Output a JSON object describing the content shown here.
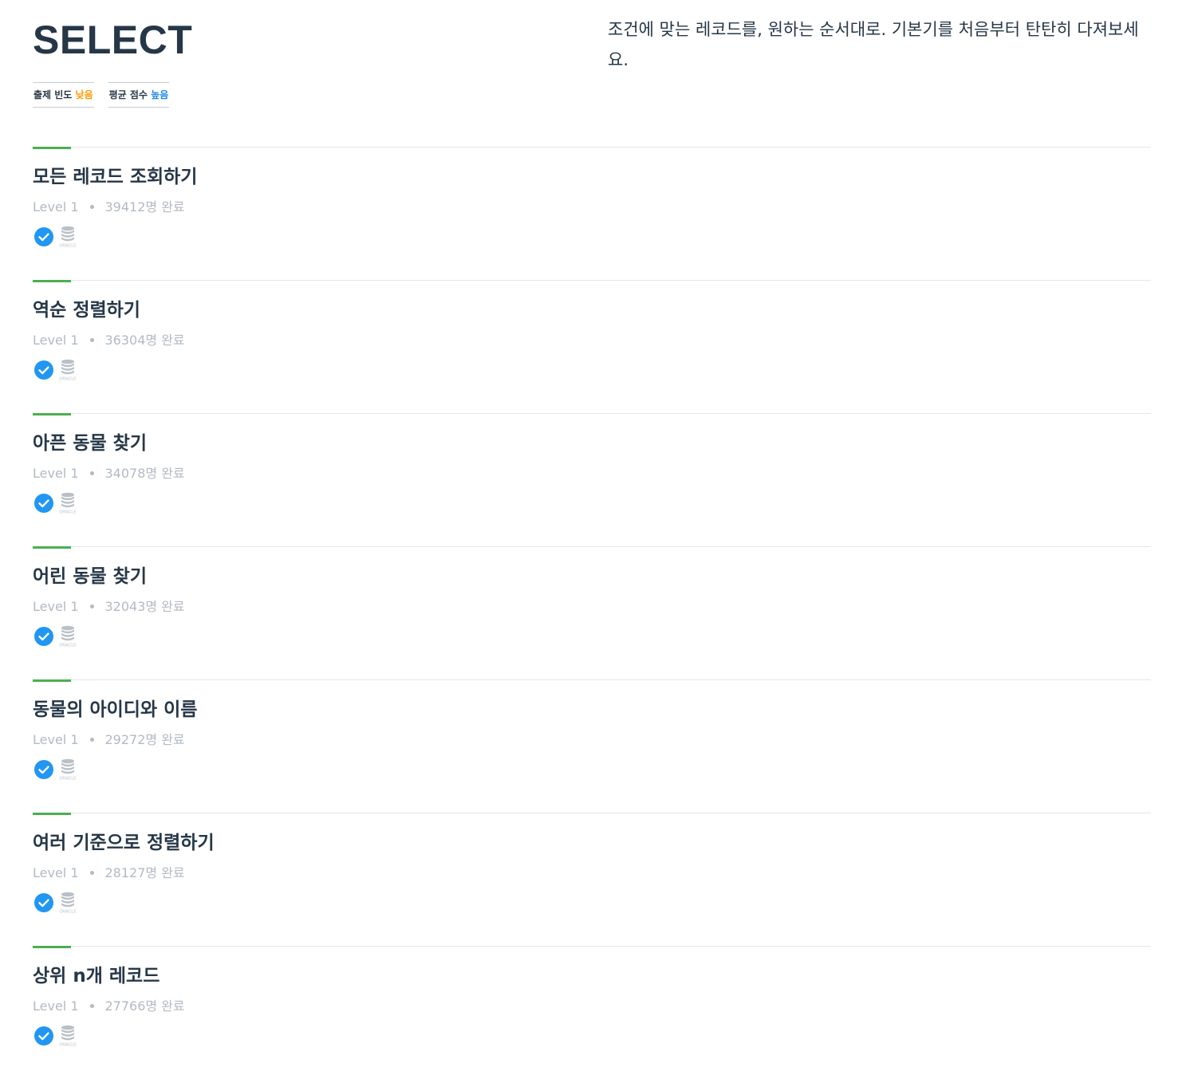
{
  "header": {
    "title": "SELECT",
    "description": "조건에 맞는 레코드를, 원하는 순서대로. 기본기를 처음부터 탄탄히 다져보세요.",
    "badges": [
      {
        "label": "출제 빈도",
        "value": "낮음",
        "color": "#ff9800"
      },
      {
        "label": "평균 점수",
        "value": "높음",
        "color": "#1e88e5"
      }
    ]
  },
  "colors": {
    "accent_bar": "#4caf50",
    "check": "#2196f3",
    "muted": "#b2bac2",
    "text": "#263747"
  },
  "problems": [
    {
      "title": "모든 레코드 조회하기",
      "level": "Level 1",
      "completed": "39412명 완료",
      "solved": true,
      "language_icon": "oracle-database-icon",
      "language_label": "ORACLE"
    },
    {
      "title": "역순 정렬하기",
      "level": "Level 1",
      "completed": "36304명 완료",
      "solved": true,
      "language_icon": "oracle-database-icon",
      "language_label": "ORACLE"
    },
    {
      "title": "아픈 동물 찾기",
      "level": "Level 1",
      "completed": "34078명 완료",
      "solved": true,
      "language_icon": "oracle-database-icon",
      "language_label": "ORACLE"
    },
    {
      "title": "어린 동물 찾기",
      "level": "Level 1",
      "completed": "32043명 완료",
      "solved": true,
      "language_icon": "oracle-database-icon",
      "language_label": "ORACLE"
    },
    {
      "title": "동물의 아이디와 이름",
      "level": "Level 1",
      "completed": "29272명 완료",
      "solved": true,
      "language_icon": "oracle-database-icon",
      "language_label": "ORACLE"
    },
    {
      "title": "여러 기준으로 정렬하기",
      "level": "Level 1",
      "completed": "28127명 완료",
      "solved": true,
      "language_icon": "oracle-database-icon",
      "language_label": "ORACLE"
    },
    {
      "title": "상위 n개 레코드",
      "level": "Level 1",
      "completed": "27766명 완료",
      "solved": true,
      "language_icon": "oracle-database-icon",
      "language_label": "ORACLE"
    }
  ]
}
